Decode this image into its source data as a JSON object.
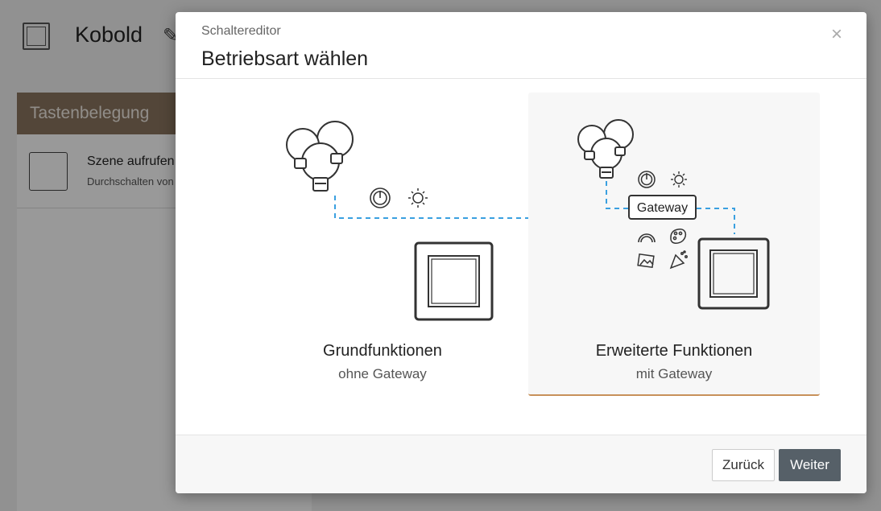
{
  "background": {
    "title": "Kobold",
    "panel_title": "Tastenbelegung",
    "row_title": "Szene aufrufen",
    "row_subtitle": "Durchschalten von"
  },
  "modal": {
    "kicker": "Schaltereditor",
    "title": "Betriebsart wählen",
    "close_label": "×",
    "options": [
      {
        "title": "Grundfunktionen",
        "subtitle": "ohne Gateway",
        "selected": false
      },
      {
        "title": "Erweiterte Funktionen",
        "subtitle": "mit Gateway",
        "gateway_label": "Gateway",
        "selected": true
      }
    ],
    "buttons": {
      "back": "Zurück",
      "next": "Weiter"
    }
  },
  "colors": {
    "accent_line": "#c8915a",
    "dashed_connector": "#3aa0e0",
    "primary_button": "#566068",
    "panel_header": "#8a7560"
  },
  "icons": [
    "close-icon",
    "bulbs-icon",
    "power-icon",
    "brightness-icon",
    "switch-icon",
    "gateway-icon",
    "color-temperature-icon",
    "palette-icon",
    "image-scene-icon",
    "party-icon",
    "pencil-icon",
    "checkbox-icon"
  ]
}
